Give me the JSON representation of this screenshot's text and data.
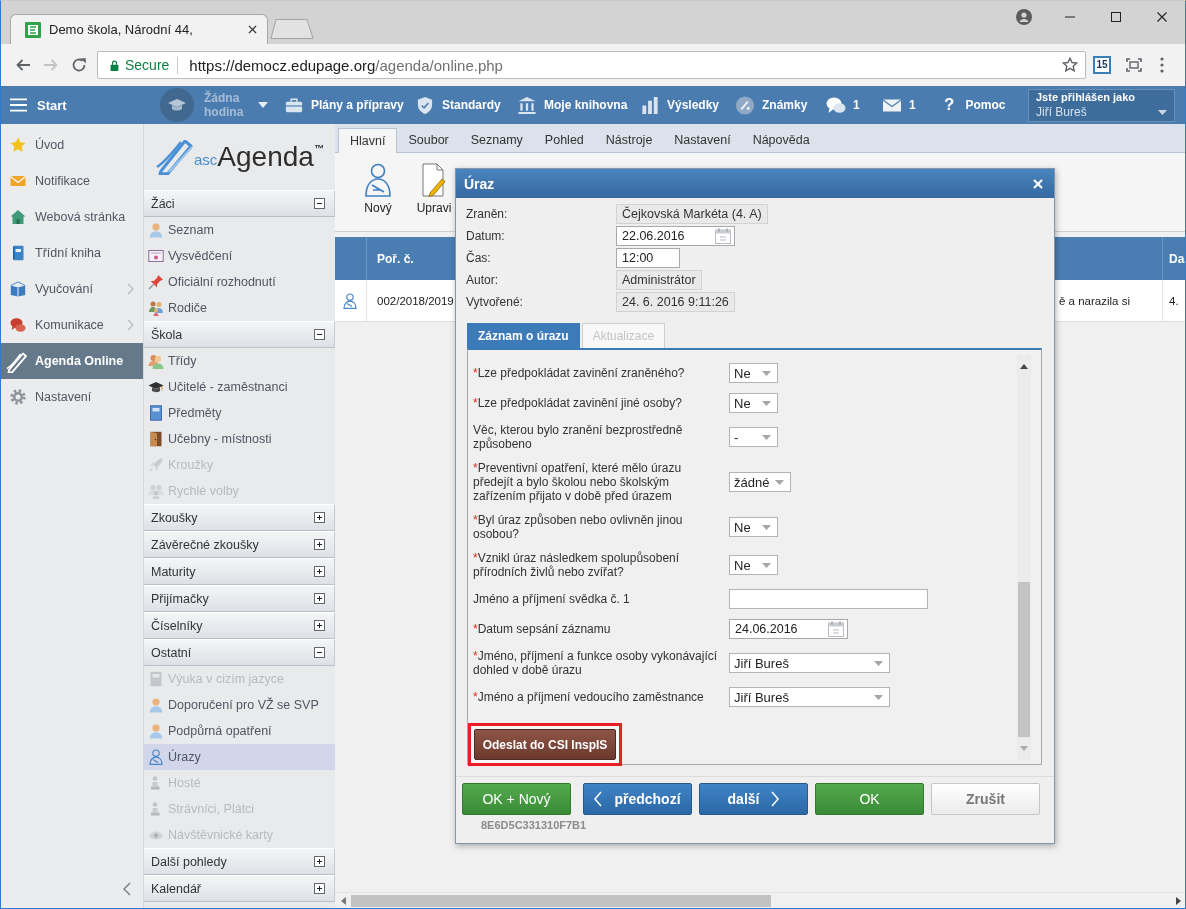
{
  "browser": {
    "tab_title": "Demo škola, Národní 44,",
    "secure_label": "Secure",
    "url_host": "https://democz.edupage.org",
    "url_path": "/agenda/online.php",
    "extension_badge": "15"
  },
  "nav": {
    "start": "Start",
    "lesson": "Žádna hodina",
    "items": [
      "Plány a přípravy",
      "Standardy",
      "Moje knihovna",
      "Výsledky",
      "Známky"
    ],
    "chat_count": "1",
    "mail_count": "1",
    "help_glyph": "?",
    "help": "Pomoc",
    "user_caption": "Jste přihlášen jako",
    "user_name": "Jiří Bureš"
  },
  "sidebar": {
    "items": [
      {
        "label": "Úvod",
        "selected": false,
        "has_submenu": false
      },
      {
        "label": "Notifikace",
        "selected": false,
        "has_submenu": false
      },
      {
        "label": "Webová stránka",
        "selected": false,
        "has_submenu": false
      },
      {
        "label": "Třídní kniha",
        "selected": false,
        "has_submenu": false
      },
      {
        "label": "Vyučování",
        "selected": false,
        "has_submenu": true
      },
      {
        "label": "Komunikace",
        "selected": false,
        "has_submenu": true
      },
      {
        "label": "Agenda Online",
        "selected": true,
        "has_submenu": false
      },
      {
        "label": "Nastavení",
        "selected": false,
        "has_submenu": false
      }
    ]
  },
  "agenda": {
    "logo": {
      "prefix": "asc",
      "name": "Agenda",
      "mark": "™"
    },
    "sections": [
      {
        "title": "Žáci",
        "expanded": true,
        "items": [
          {
            "label": "Seznam",
            "disabled": false,
            "selected": false
          },
          {
            "label": "Vysvědčení",
            "disabled": false,
            "selected": false
          },
          {
            "label": "Oficiální rozhodnutí",
            "disabled": false,
            "selected": false
          },
          {
            "label": "Rodiče",
            "disabled": false,
            "selected": false
          }
        ]
      },
      {
        "title": "Škola",
        "expanded": true,
        "items": [
          {
            "label": "Třídy",
            "disabled": false,
            "selected": false
          },
          {
            "label": "Učitelé - zaměstnanci",
            "disabled": false,
            "selected": false
          },
          {
            "label": "Předměty",
            "disabled": false,
            "selected": false
          },
          {
            "label": "Učebny - místnosti",
            "disabled": false,
            "selected": false
          },
          {
            "label": "Kroužky",
            "disabled": true,
            "selected": false
          },
          {
            "label": "Rychlé volby",
            "disabled": true,
            "selected": false
          }
        ]
      },
      {
        "title": "Zkoušky",
        "expanded": false
      },
      {
        "title": "Závěrečné zkoušky",
        "expanded": false
      },
      {
        "title": "Maturity",
        "expanded": false
      },
      {
        "title": "Přijímačky",
        "expanded": false
      },
      {
        "title": "Číselníky",
        "expanded": false
      },
      {
        "title": "Ostatní",
        "expanded": true,
        "items": [
          {
            "label": "Výuka v cizím jazyce",
            "disabled": true,
            "selected": false
          },
          {
            "label": "Doporučení pro VŽ se SVP",
            "disabled": false,
            "selected": false
          },
          {
            "label": "Podpůrná opatření",
            "disabled": false,
            "selected": false
          },
          {
            "label": "Úrazy",
            "disabled": false,
            "selected": true
          },
          {
            "label": "Hosté",
            "disabled": true,
            "selected": false
          },
          {
            "label": "Strávníci, Plátci",
            "disabled": true,
            "selected": false
          },
          {
            "label": "Návštěvnické karty",
            "disabled": true,
            "selected": false
          }
        ]
      },
      {
        "title": "Další pohledy",
        "expanded": false
      },
      {
        "title": "Kalendář",
        "expanded": false
      }
    ]
  },
  "ribbon": {
    "tabs": [
      {
        "label": "Hlavní",
        "selected": true
      },
      {
        "label": "Soubor",
        "selected": false
      },
      {
        "label": "Seznamy",
        "selected": false
      },
      {
        "label": "Pohled",
        "selected": false
      },
      {
        "label": "Nástroje",
        "selected": false
      },
      {
        "label": "Nastavení",
        "selected": false
      },
      {
        "label": "Nápověda",
        "selected": false
      }
    ],
    "buttons": [
      "Nový",
      "Upravi"
    ]
  },
  "table": {
    "columns": [
      "Poř. č.",
      "Da"
    ],
    "rows": [
      {
        "number": "002/2018/2019",
        "description": "ě a narazila si",
        "date": "4."
      }
    ]
  },
  "dialog": {
    "title": "Úraz",
    "fields": [
      {
        "label": "Zraněn:",
        "value": "Čejkovská Markéta (4. A)",
        "kind": "readonly"
      },
      {
        "label": "Datum:",
        "value": "22.06.2016",
        "kind": "date"
      },
      {
        "label": "Čas:",
        "value": "12:00",
        "kind": "text"
      },
      {
        "label": "Autor:",
        "value": "Administrátor",
        "kind": "readonly"
      },
      {
        "label": "Vytvořené:",
        "value": "24. 6. 2016 9:11:26",
        "kind": "readonly"
      }
    ],
    "tabs": [
      {
        "label": "Záznam o úrazu",
        "selected": true,
        "disabled": false
      },
      {
        "label": "Aktualizace",
        "selected": false,
        "disabled": true
      }
    ],
    "form": [
      {
        "required_mark": "*",
        "label": "Lze předpokládat zavinění zraněného?",
        "value": "Ne",
        "kind": "select"
      },
      {
        "required_mark": "*",
        "label": "Lze předpokládat zavinění jiné osoby?",
        "value": "Ne",
        "kind": "select"
      },
      {
        "label": "Věc, kterou bylo zranění bezprostředně způsobeno",
        "value": "-",
        "kind": "select"
      },
      {
        "required_mark": "*",
        "label": "Preventivní opatření, které mělo úrazu předejít a bylo školou nebo školským zařízením přijato v době před úrazem",
        "value": "žádné",
        "kind": "select"
      },
      {
        "required_mark": "*",
        "label": "Byl úraz způsoben nebo ovlivněn jinou osobou?",
        "value": "Ne",
        "kind": "select"
      },
      {
        "required_mark": "*",
        "label": "Vznikl úraz následkem spolupůsobení přírodních živlů nebo zvířat?",
        "value": "Ne",
        "kind": "select"
      },
      {
        "label": "Jméno a příjmení svědka č. 1",
        "kind": "text"
      },
      {
        "required_mark": "*",
        "label": "Datum sepsání záznamu",
        "value": "24.06.2016",
        "kind": "date"
      },
      {
        "required_mark": "*",
        "label": "Jméno, příjmení a funkce osoby vykonávající dohled v době úrazu",
        "value": "Jiří Bureš",
        "kind": "combo"
      },
      {
        "required_mark": "*",
        "label": "Jméno a příjmení vedoucího zaměstnance",
        "value": "Jiří Bureš",
        "kind": "combo"
      }
    ],
    "send_button": {
      "label": "Odeslat do CSI InspIS",
      "highlighted": true
    },
    "buttons": [
      {
        "label": "OK + Nový",
        "kind": "confirm"
      },
      {
        "label": "předchozí",
        "kind": "previous"
      },
      {
        "label": "další",
        "kind": "next"
      },
      {
        "label": "OK",
        "kind": "confirm"
      },
      {
        "label": "Zrušit",
        "kind": "cancel"
      }
    ],
    "record_id": "8E6D5C331310F7B1"
  }
}
